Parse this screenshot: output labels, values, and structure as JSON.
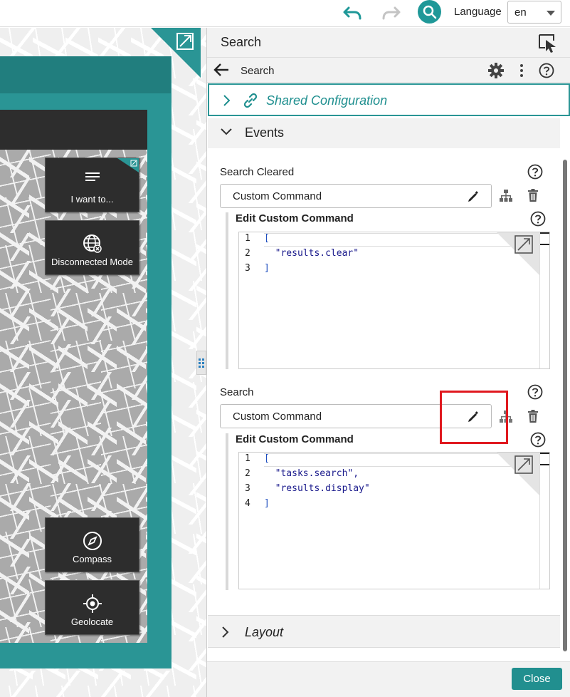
{
  "topbar": {
    "undo_icon": "undo-arrow-icon",
    "redo_icon": "redo-arrow-icon",
    "search_icon": "search-icon",
    "language_label": "Language",
    "language_value": "en"
  },
  "map_preview": {
    "buttons": {
      "i_want_to": "I want to...",
      "disconnected_mode": "Disconnected Mode",
      "compass": "Compass",
      "geolocate": "Geolocate"
    }
  },
  "panel": {
    "title": "Search",
    "sub_title": "Search",
    "shared_configuration": "Shared Configuration",
    "events_section": "Events",
    "layout_section": "Layout",
    "close_label": "Close",
    "events": [
      {
        "label": "Search Cleared",
        "command_type": "Custom Command",
        "edit_label": "Edit Custom Command",
        "code": {
          "numbers": [
            "1",
            "2",
            "3"
          ],
          "lines": [
            "[",
            "  \"results.clear\"",
            "]"
          ]
        }
      },
      {
        "label": "Search",
        "command_type": "Custom Command",
        "edit_label": "Edit Custom Command",
        "code": {
          "numbers": [
            "1",
            "2",
            "3",
            "4"
          ],
          "lines": [
            "[",
            "  \"tasks.search\",",
            "  \"results.display\"",
            "]"
          ]
        }
      }
    ]
  },
  "colors": {
    "accent": "#2a9595",
    "accent_dark": "#217e7e",
    "highlight": "#e0191f",
    "map_button_bg": "#2d2d2d"
  }
}
